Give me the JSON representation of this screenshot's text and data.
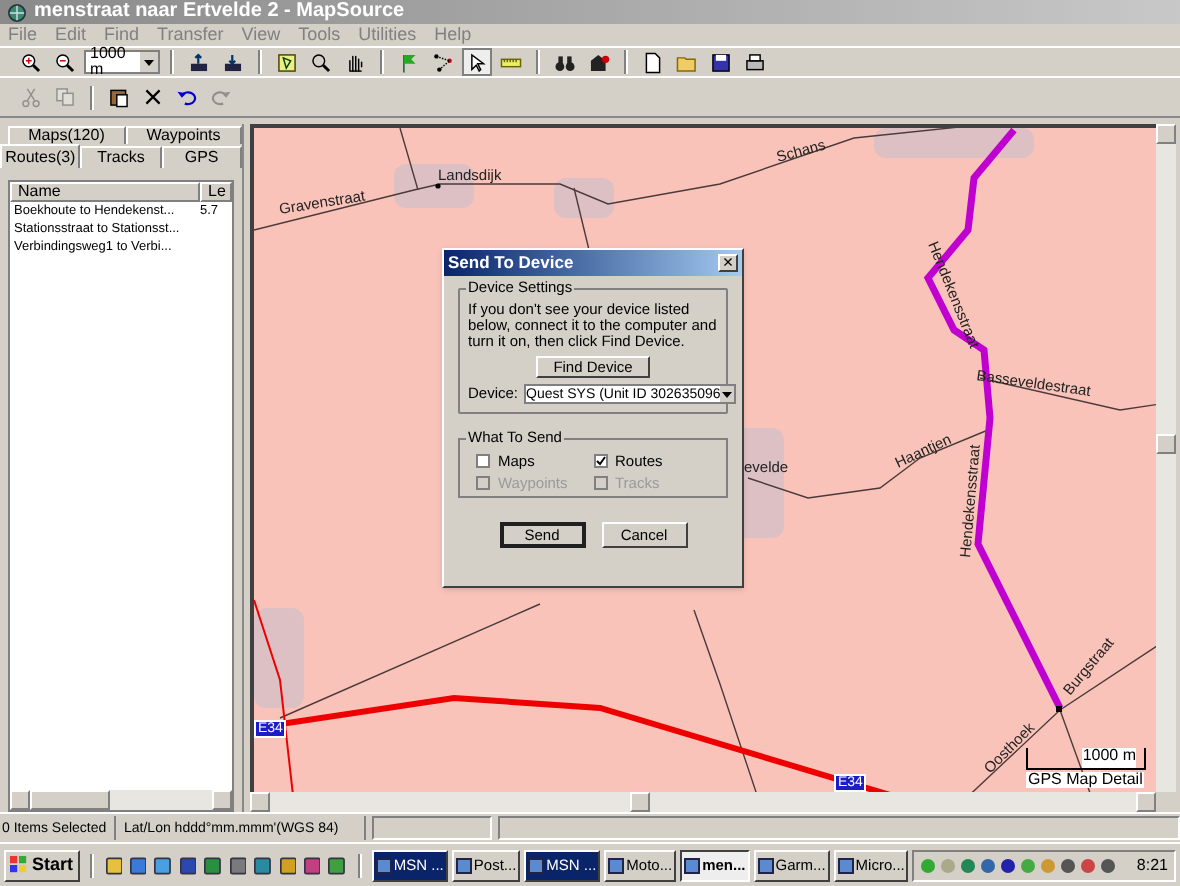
{
  "window": {
    "title": "menstraat naar Ertvelde 2 - MapSource"
  },
  "menu": [
    "File",
    "Edit",
    "Find",
    "Transfer",
    "View",
    "Tools",
    "Utilities",
    "Help"
  ],
  "zoom_combo": {
    "value": "1000 m"
  },
  "edit_toolbar": [
    {
      "disabled": true
    },
    {
      "disabled": true
    },
    {
      "disabled": false
    },
    {
      "disabled": false
    },
    {
      "disabled": false
    },
    {
      "disabled": true
    }
  ],
  "left_panel": {
    "tabs_back": [
      {
        "label": "Maps(120)",
        "selected": false
      },
      {
        "label": "Waypoints",
        "selected": false
      }
    ],
    "tabs_front": [
      {
        "label": "Routes(3)",
        "selected": true
      },
      {
        "label": "Tracks",
        "selected": false
      },
      {
        "label": "GPS",
        "selected": false
      }
    ],
    "columns": [
      "Name",
      "Le"
    ],
    "rows": [
      {
        "name": "Boekhoute to Hendekenst...",
        "length": "5.7"
      },
      {
        "name": "Stationsstraat to Stationsst...",
        "length": ""
      },
      {
        "name": "Verbindingsweg1 to Verbi...",
        "length": ""
      }
    ]
  },
  "map": {
    "labels": [
      "Gravenstraat",
      "Landsdijk",
      "Schans",
      "evelde",
      "Haantjen",
      "Basseveldestraat",
      "Hendekensstraat",
      "Hendekensstraat",
      "Burgstraat",
      "Oosthoek"
    ],
    "road_badges": [
      "E34",
      "E34"
    ],
    "scale": "1000 m",
    "map_detail": "GPS Map Detail"
  },
  "dialog": {
    "title": "Send To Device",
    "close": "×",
    "device_group": "Device Settings",
    "hint": "If you don't see your device listed below, connect it to the computer and turn it on, then click Find Device.",
    "find_button": "Find Device",
    "device_label": "Device:",
    "device_value": "Quest SYS (Unit ID 302635096",
    "send_group": "What To Send",
    "options": [
      {
        "label": "Maps",
        "checked": false,
        "disabled": false
      },
      {
        "label": "Routes",
        "checked": true,
        "disabled": false
      },
      {
        "label": "Waypoints",
        "checked": false,
        "disabled": true
      },
      {
        "label": "Tracks",
        "checked": false,
        "disabled": true
      }
    ],
    "buttons": [
      {
        "label": "Send",
        "default": true
      },
      {
        "label": "Cancel",
        "default": false
      }
    ]
  },
  "status_bar": [
    "0 Items Selected",
    "Lat/Lon hddd°mm.mmm'(WGS 84)"
  ],
  "taskbar": {
    "start": "Start",
    "buttons": [
      {
        "label": "MSN ...",
        "selected": false,
        "flashing": true
      },
      {
        "label": "Post...",
        "selected": false,
        "flashing": false
      },
      {
        "label": "MSN ...",
        "selected": false,
        "flashing": true
      },
      {
        "label": "Moto...",
        "selected": false,
        "flashing": false
      },
      {
        "label": "men...",
        "selected": true,
        "flashing": false
      },
      {
        "label": "Garm...",
        "selected": false,
        "flashing": false
      },
      {
        "label": "Micro...",
        "selected": false,
        "flashing": false
      }
    ],
    "clock": "8:21"
  }
}
